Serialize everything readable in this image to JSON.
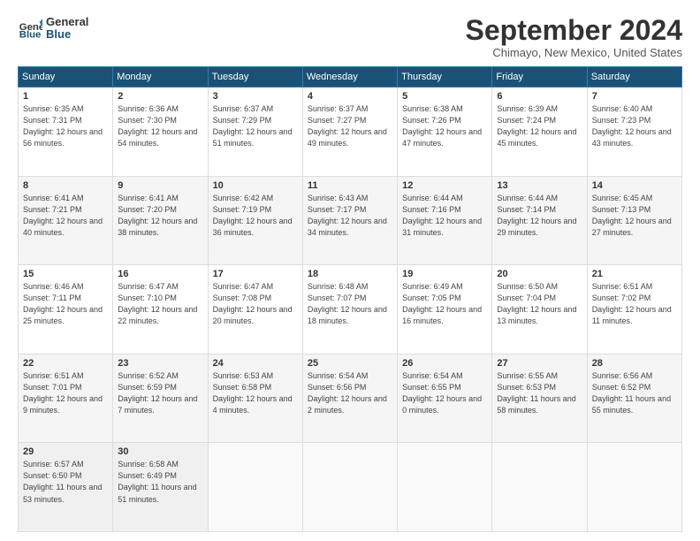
{
  "logo": {
    "line1": "General",
    "line2": "Blue"
  },
  "title": "September 2024",
  "location": "Chimayo, New Mexico, United States",
  "headers": [
    "Sunday",
    "Monday",
    "Tuesday",
    "Wednesday",
    "Thursday",
    "Friday",
    "Saturday"
  ],
  "weeks": [
    [
      {
        "day": "1",
        "sunrise": "6:35 AM",
        "sunset": "7:31 PM",
        "daylight": "12 hours and 56 minutes."
      },
      {
        "day": "2",
        "sunrise": "6:36 AM",
        "sunset": "7:30 PM",
        "daylight": "12 hours and 54 minutes."
      },
      {
        "day": "3",
        "sunrise": "6:37 AM",
        "sunset": "7:29 PM",
        "daylight": "12 hours and 51 minutes."
      },
      {
        "day": "4",
        "sunrise": "6:37 AM",
        "sunset": "7:27 PM",
        "daylight": "12 hours and 49 minutes."
      },
      {
        "day": "5",
        "sunrise": "6:38 AM",
        "sunset": "7:26 PM",
        "daylight": "12 hours and 47 minutes."
      },
      {
        "day": "6",
        "sunrise": "6:39 AM",
        "sunset": "7:24 PM",
        "daylight": "12 hours and 45 minutes."
      },
      {
        "day": "7",
        "sunrise": "6:40 AM",
        "sunset": "7:23 PM",
        "daylight": "12 hours and 43 minutes."
      }
    ],
    [
      {
        "day": "8",
        "sunrise": "6:41 AM",
        "sunset": "7:21 PM",
        "daylight": "12 hours and 40 minutes."
      },
      {
        "day": "9",
        "sunrise": "6:41 AM",
        "sunset": "7:20 PM",
        "daylight": "12 hours and 38 minutes."
      },
      {
        "day": "10",
        "sunrise": "6:42 AM",
        "sunset": "7:19 PM",
        "daylight": "12 hours and 36 minutes."
      },
      {
        "day": "11",
        "sunrise": "6:43 AM",
        "sunset": "7:17 PM",
        "daylight": "12 hours and 34 minutes."
      },
      {
        "day": "12",
        "sunrise": "6:44 AM",
        "sunset": "7:16 PM",
        "daylight": "12 hours and 31 minutes."
      },
      {
        "day": "13",
        "sunrise": "6:44 AM",
        "sunset": "7:14 PM",
        "daylight": "12 hours and 29 minutes."
      },
      {
        "day": "14",
        "sunrise": "6:45 AM",
        "sunset": "7:13 PM",
        "daylight": "12 hours and 27 minutes."
      }
    ],
    [
      {
        "day": "15",
        "sunrise": "6:46 AM",
        "sunset": "7:11 PM",
        "daylight": "12 hours and 25 minutes."
      },
      {
        "day": "16",
        "sunrise": "6:47 AM",
        "sunset": "7:10 PM",
        "daylight": "12 hours and 22 minutes."
      },
      {
        "day": "17",
        "sunrise": "6:47 AM",
        "sunset": "7:08 PM",
        "daylight": "12 hours and 20 minutes."
      },
      {
        "day": "18",
        "sunrise": "6:48 AM",
        "sunset": "7:07 PM",
        "daylight": "12 hours and 18 minutes."
      },
      {
        "day": "19",
        "sunrise": "6:49 AM",
        "sunset": "7:05 PM",
        "daylight": "12 hours and 16 minutes."
      },
      {
        "day": "20",
        "sunrise": "6:50 AM",
        "sunset": "7:04 PM",
        "daylight": "12 hours and 13 minutes."
      },
      {
        "day": "21",
        "sunrise": "6:51 AM",
        "sunset": "7:02 PM",
        "daylight": "12 hours and 11 minutes."
      }
    ],
    [
      {
        "day": "22",
        "sunrise": "6:51 AM",
        "sunset": "7:01 PM",
        "daylight": "12 hours and 9 minutes."
      },
      {
        "day": "23",
        "sunrise": "6:52 AM",
        "sunset": "6:59 PM",
        "daylight": "12 hours and 7 minutes."
      },
      {
        "day": "24",
        "sunrise": "6:53 AM",
        "sunset": "6:58 PM",
        "daylight": "12 hours and 4 minutes."
      },
      {
        "day": "25",
        "sunrise": "6:54 AM",
        "sunset": "6:56 PM",
        "daylight": "12 hours and 2 minutes."
      },
      {
        "day": "26",
        "sunrise": "6:54 AM",
        "sunset": "6:55 PM",
        "daylight": "12 hours and 0 minutes."
      },
      {
        "day": "27",
        "sunrise": "6:55 AM",
        "sunset": "6:53 PM",
        "daylight": "11 hours and 58 minutes."
      },
      {
        "day": "28",
        "sunrise": "6:56 AM",
        "sunset": "6:52 PM",
        "daylight": "11 hours and 55 minutes."
      }
    ],
    [
      {
        "day": "29",
        "sunrise": "6:57 AM",
        "sunset": "6:50 PM",
        "daylight": "11 hours and 53 minutes."
      },
      {
        "day": "30",
        "sunrise": "6:58 AM",
        "sunset": "6:49 PM",
        "daylight": "11 hours and 51 minutes."
      },
      null,
      null,
      null,
      null,
      null
    ]
  ]
}
